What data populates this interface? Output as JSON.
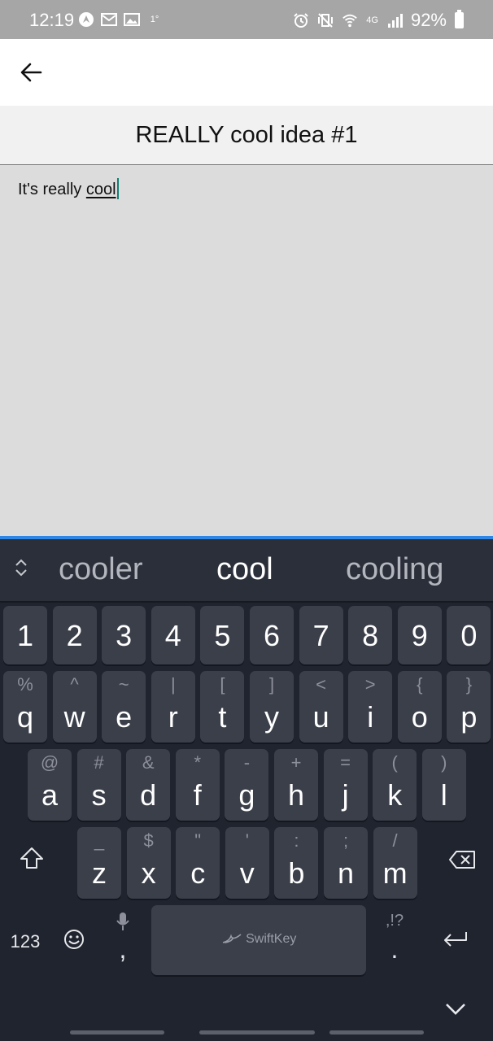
{
  "status_bar": {
    "time": "12:19",
    "temp": "1°",
    "battery": "92%",
    "network": "4G"
  },
  "app_bar": {
    "back_icon": "arrow-left-icon"
  },
  "note": {
    "title": "REALLY cool idea #1",
    "body_prefix": "It's really ",
    "body_current_word": "cool"
  },
  "keyboard": {
    "brand": "SwiftKey",
    "suggestions": [
      "cooler",
      "cool",
      "cooling"
    ],
    "row_numbers": [
      "1",
      "2",
      "3",
      "4",
      "5",
      "6",
      "7",
      "8",
      "9",
      "0"
    ],
    "row1": [
      {
        "k": "q",
        "s": "%"
      },
      {
        "k": "w",
        "s": "^"
      },
      {
        "k": "e",
        "s": "~"
      },
      {
        "k": "r",
        "s": "|"
      },
      {
        "k": "t",
        "s": "["
      },
      {
        "k": "y",
        "s": "]"
      },
      {
        "k": "u",
        "s": "<"
      },
      {
        "k": "i",
        "s": ">"
      },
      {
        "k": "o",
        "s": "{"
      },
      {
        "k": "p",
        "s": "}"
      }
    ],
    "row2": [
      {
        "k": "a",
        "s": "@"
      },
      {
        "k": "s",
        "s": "#"
      },
      {
        "k": "d",
        "s": "&"
      },
      {
        "k": "f",
        "s": "*"
      },
      {
        "k": "g",
        "s": "-"
      },
      {
        "k": "h",
        "s": "+"
      },
      {
        "k": "j",
        "s": "="
      },
      {
        "k": "k",
        "s": "("
      },
      {
        "k": "l",
        "s": ")"
      }
    ],
    "row3": [
      {
        "k": "z",
        "s": "_"
      },
      {
        "k": "x",
        "s": "$"
      },
      {
        "k": "c",
        "s": "\""
      },
      {
        "k": "v",
        "s": "'"
      },
      {
        "k": "b",
        "s": ":"
      },
      {
        "k": "n",
        "s": ";"
      },
      {
        "k": "m",
        "s": "/"
      }
    ],
    "numbers_key": "123",
    "comma": ",",
    "period": ".",
    "period_secondary": ",!?"
  }
}
